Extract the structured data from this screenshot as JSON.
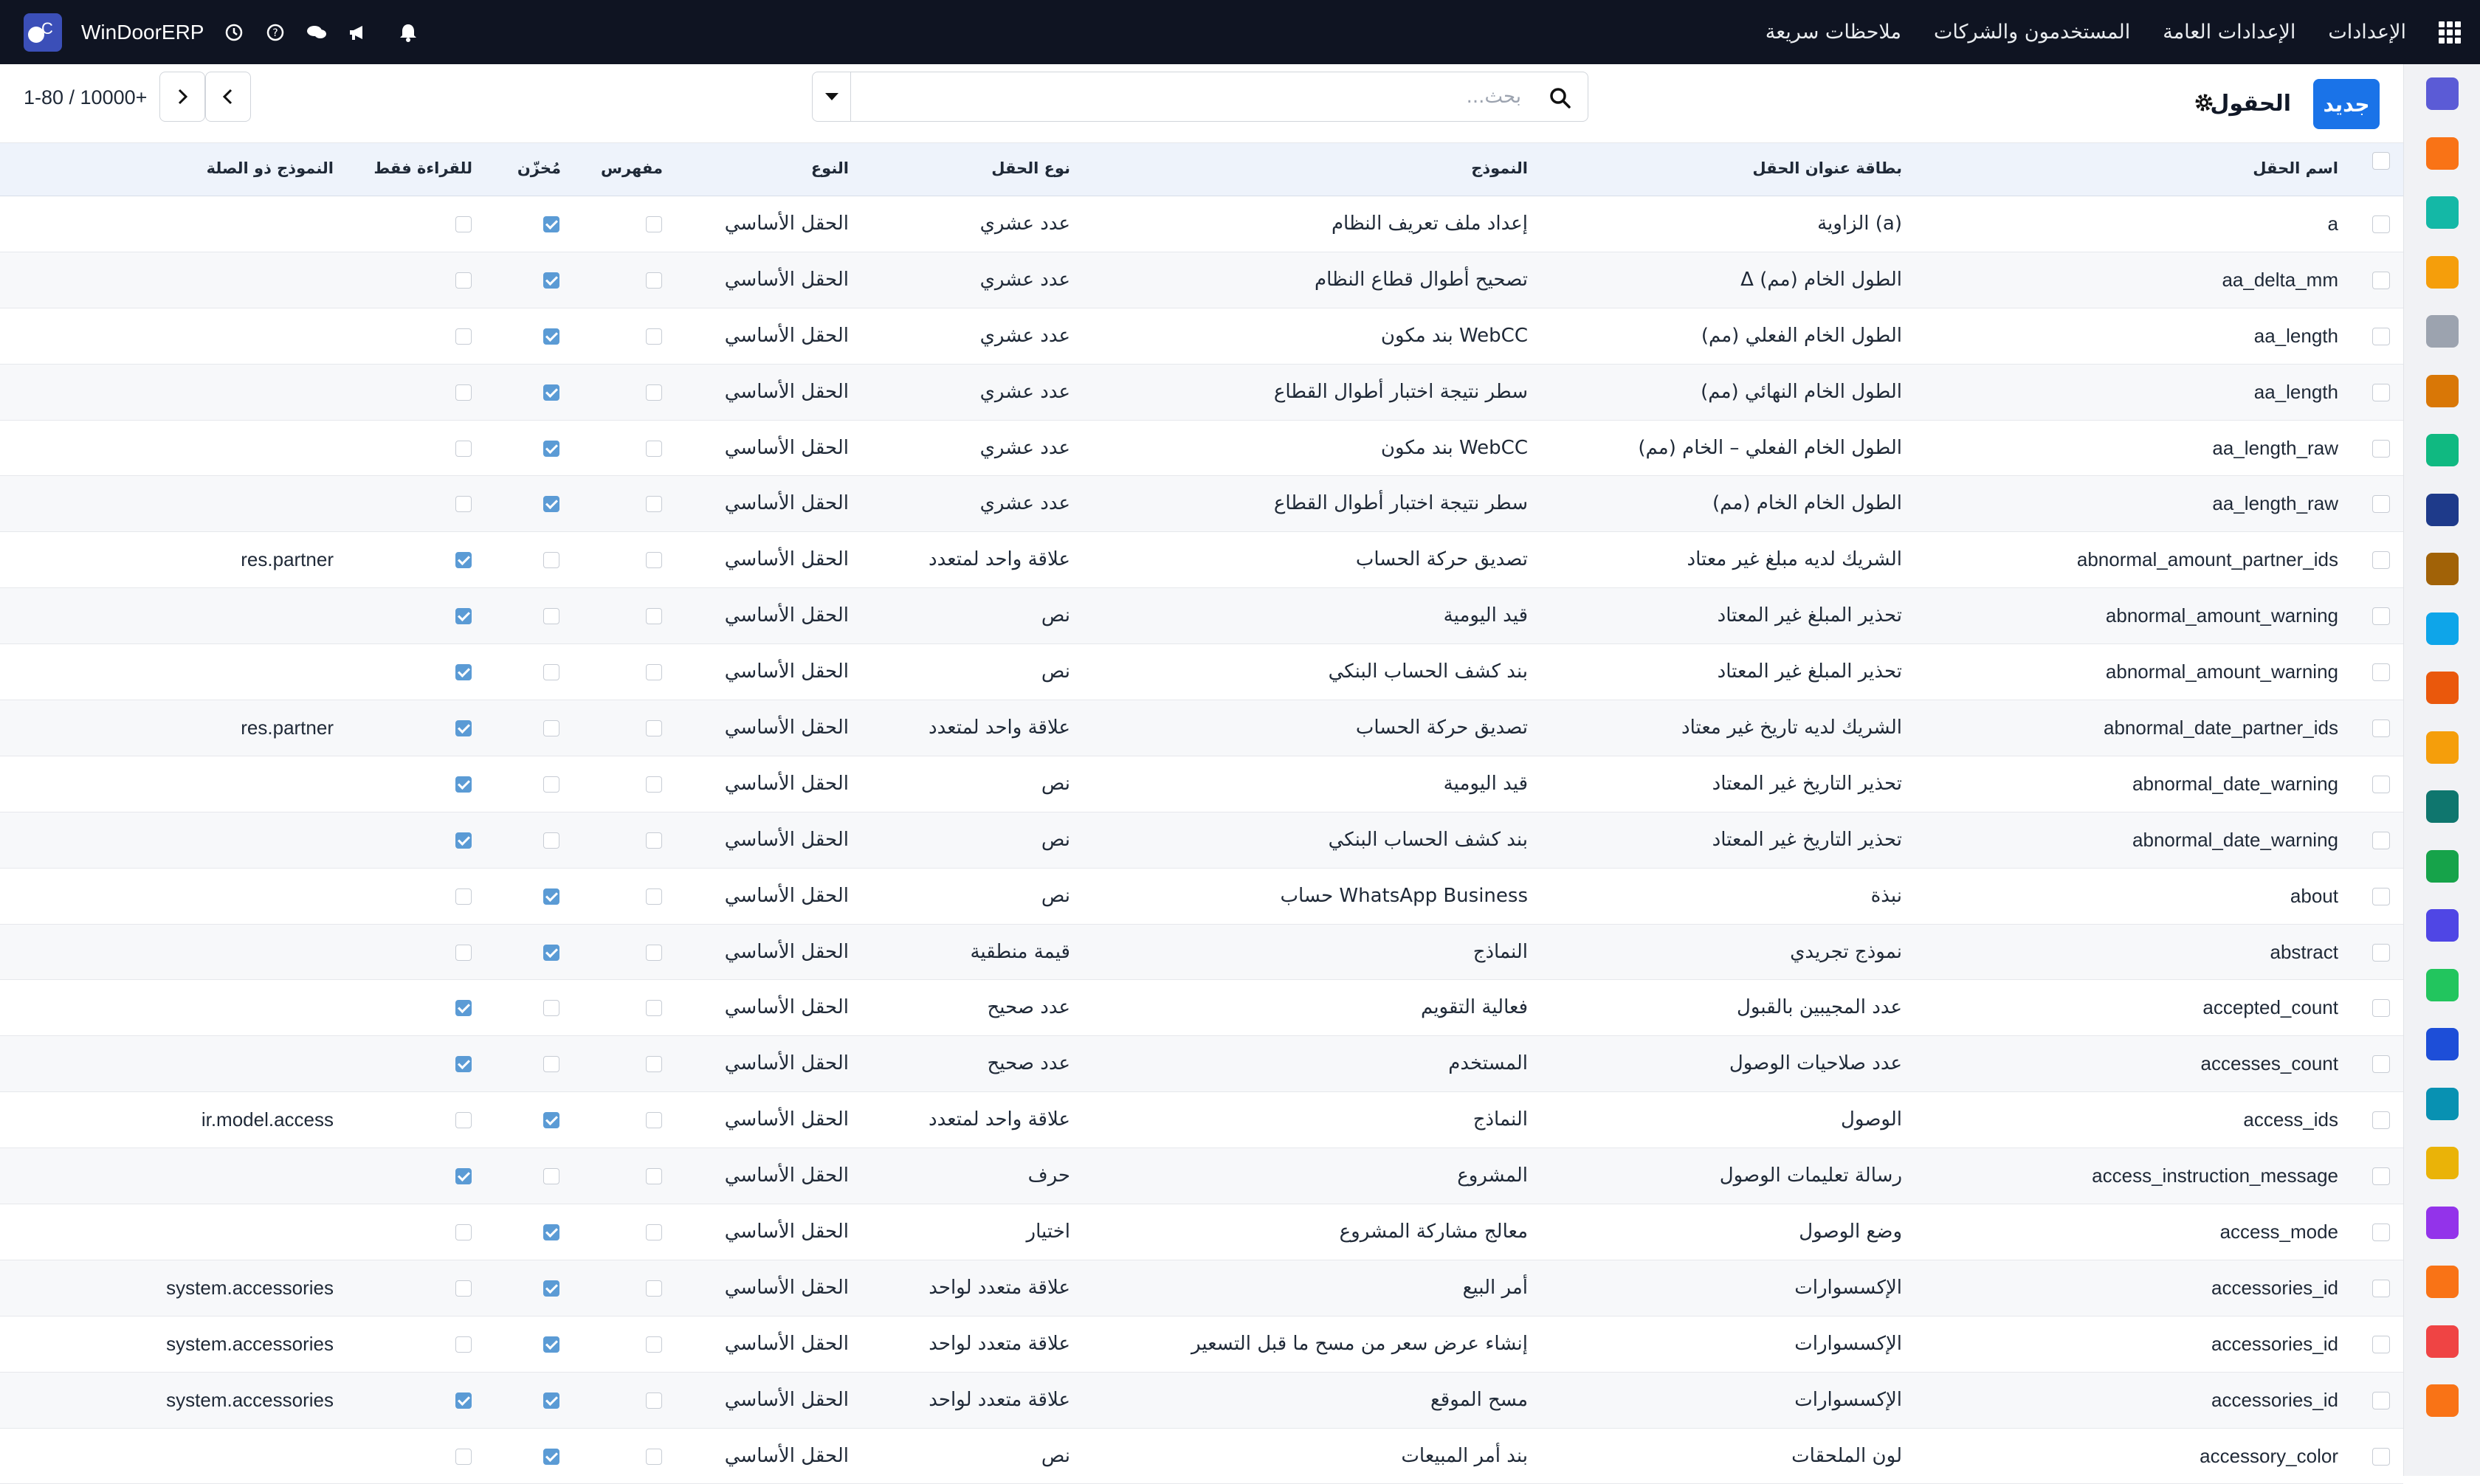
{
  "navbar": {
    "brand": "WinDoorERP",
    "menu": [
      "الإعدادات",
      "الإعدادات العامة",
      "المستخدمون والشركات",
      "ملاحظات سريعة"
    ]
  },
  "control": {
    "new_button": "جديد",
    "title": "الحقول",
    "search_placeholder": "بحث...",
    "pager": "1-80 / 10000+"
  },
  "columns": [
    "اسم الحقل",
    "بطاقة عنوان الحقل",
    "النموذج",
    "نوع الحقل",
    "النوع",
    "مفهرس",
    "مُخزّن",
    "للقراءة فقط",
    "النموذج ذو الصلة"
  ],
  "rows": [
    {
      "name": "a",
      "label": "الزاوية (a)",
      "model": "إعداد ملف تعريف النظام",
      "ftype": "عدد عشري",
      "kind": "الحقل الأساسي",
      "indexed": false,
      "stored": true,
      "readonly": false,
      "relation": ""
    },
    {
      "name": "aa_delta_mm",
      "label": "Δ الطول الخام (مم)",
      "model": "تصحيح أطوال قطاع النظام",
      "ftype": "عدد عشري",
      "kind": "الحقل الأساسي",
      "indexed": false,
      "stored": true,
      "readonly": false,
      "relation": ""
    },
    {
      "name": "aa_length",
      "label": "الطول الخام الفعلي (مم)",
      "model": "بند مكون WebCC",
      "ftype": "عدد عشري",
      "kind": "الحقل الأساسي",
      "indexed": false,
      "stored": true,
      "readonly": false,
      "relation": ""
    },
    {
      "name": "aa_length",
      "label": "الطول الخام النهائي (مم)",
      "model": "سطر نتيجة اختبار أطوال القطاع",
      "ftype": "عدد عشري",
      "kind": "الحقل الأساسي",
      "indexed": false,
      "stored": true,
      "readonly": false,
      "relation": ""
    },
    {
      "name": "aa_length_raw",
      "label": "الطول الخام الفعلي – الخام (مم)",
      "model": "بند مكون WebCC",
      "ftype": "عدد عشري",
      "kind": "الحقل الأساسي",
      "indexed": false,
      "stored": true,
      "readonly": false,
      "relation": ""
    },
    {
      "name": "aa_length_raw",
      "label": "الطول الخام الخام (مم)",
      "model": "سطر نتيجة اختبار أطوال القطاع",
      "ftype": "عدد عشري",
      "kind": "الحقل الأساسي",
      "indexed": false,
      "stored": true,
      "readonly": false,
      "relation": ""
    },
    {
      "name": "abnormal_amount_partner_ids",
      "label": "الشريك لديه مبلغ غير معتاد",
      "model": "تصديق حركة الحساب",
      "ftype": "علاقة واحد لمتعدد",
      "kind": "الحقل الأساسي",
      "indexed": false,
      "stored": false,
      "readonly": true,
      "relation": "res.partner"
    },
    {
      "name": "abnormal_amount_warning",
      "label": "تحذير المبلغ غير المعتاد",
      "model": "قيد اليومية",
      "ftype": "نص",
      "kind": "الحقل الأساسي",
      "indexed": false,
      "stored": false,
      "readonly": true,
      "relation": ""
    },
    {
      "name": "abnormal_amount_warning",
      "label": "تحذير المبلغ غير المعتاد",
      "model": "بند كشف الحساب البنكي",
      "ftype": "نص",
      "kind": "الحقل الأساسي",
      "indexed": false,
      "stored": false,
      "readonly": true,
      "relation": ""
    },
    {
      "name": "abnormal_date_partner_ids",
      "label": "الشريك لديه تاريخ غير معتاد",
      "model": "تصديق حركة الحساب",
      "ftype": "علاقة واحد لمتعدد",
      "kind": "الحقل الأساسي",
      "indexed": false,
      "stored": false,
      "readonly": true,
      "relation": "res.partner"
    },
    {
      "name": "abnormal_date_warning",
      "label": "تحذير التاريخ غير المعتاد",
      "model": "قيد اليومية",
      "ftype": "نص",
      "kind": "الحقل الأساسي",
      "indexed": false,
      "stored": false,
      "readonly": true,
      "relation": ""
    },
    {
      "name": "abnormal_date_warning",
      "label": "تحذير التاريخ غير المعتاد",
      "model": "بند كشف الحساب البنكي",
      "ftype": "نص",
      "kind": "الحقل الأساسي",
      "indexed": false,
      "stored": false,
      "readonly": true,
      "relation": ""
    },
    {
      "name": "about",
      "label": "نبذة",
      "model": "حساب WhatsApp Business",
      "ftype": "نص",
      "kind": "الحقل الأساسي",
      "indexed": false,
      "stored": true,
      "readonly": false,
      "relation": ""
    },
    {
      "name": "abstract",
      "label": "نموذج تجريدي",
      "model": "النماذج",
      "ftype": "قيمة منطقية",
      "kind": "الحقل الأساسي",
      "indexed": false,
      "stored": true,
      "readonly": false,
      "relation": ""
    },
    {
      "name": "accepted_count",
      "label": "عدد المجيبين بالقبول",
      "model": "فعالية التقويم",
      "ftype": "عدد صحيح",
      "kind": "الحقل الأساسي",
      "indexed": false,
      "stored": false,
      "readonly": true,
      "relation": ""
    },
    {
      "name": "accesses_count",
      "label": "عدد صلاحيات الوصول",
      "model": "المستخدم",
      "ftype": "عدد صحيح",
      "kind": "الحقل الأساسي",
      "indexed": false,
      "stored": false,
      "readonly": true,
      "relation": ""
    },
    {
      "name": "access_ids",
      "label": "الوصول",
      "model": "النماذج",
      "ftype": "علاقة واحد لمتعدد",
      "kind": "الحقل الأساسي",
      "indexed": false,
      "stored": true,
      "readonly": false,
      "relation": "ir.model.access"
    },
    {
      "name": "access_instruction_message",
      "label": "رسالة تعليمات الوصول",
      "model": "المشروع",
      "ftype": "حرف",
      "kind": "الحقل الأساسي",
      "indexed": false,
      "stored": false,
      "readonly": true,
      "relation": ""
    },
    {
      "name": "access_mode",
      "label": "وضع الوصول",
      "model": "معالج مشاركة المشروع",
      "ftype": "اختيار",
      "kind": "الحقل الأساسي",
      "indexed": false,
      "stored": true,
      "readonly": false,
      "relation": ""
    },
    {
      "name": "accessories_id",
      "label": "الإكسسوارات",
      "model": "أمر البيع",
      "ftype": "علاقة متعدد لواحد",
      "kind": "الحقل الأساسي",
      "indexed": false,
      "stored": true,
      "readonly": false,
      "relation": "system.accessories"
    },
    {
      "name": "accessories_id",
      "label": "الإكسسوارات",
      "model": "إنشاء عرض سعر من مسح ما قبل التسعير",
      "ftype": "علاقة متعدد لواحد",
      "kind": "الحقل الأساسي",
      "indexed": false,
      "stored": true,
      "readonly": false,
      "relation": "system.accessories"
    },
    {
      "name": "accessories_id",
      "label": "الإكسسوارات",
      "model": "مسح الموقع",
      "ftype": "علاقة متعدد لواحد",
      "kind": "الحقل الأساسي",
      "indexed": false,
      "stored": true,
      "readonly": true,
      "relation": "system.accessories"
    },
    {
      "name": "accessory_color",
      "label": "لون الملحقات",
      "model": "بند أمر المبيعات",
      "ftype": "نص",
      "kind": "الحقل الأساسي",
      "indexed": false,
      "stored": true,
      "readonly": false,
      "relation": ""
    }
  ],
  "sidebar_apps": [
    {
      "icon": "mail-app-icon",
      "color": "#5b5bd6"
    },
    {
      "icon": "chat-app-icon",
      "color": "#f97316"
    },
    {
      "icon": "sales-app-icon",
      "color": "#14b8a6"
    },
    {
      "icon": "reports-app-icon",
      "color": "#f59e0b"
    },
    {
      "icon": "inventory-app-icon",
      "color": "#9ca3af"
    },
    {
      "icon": "contacts-app-icon",
      "color": "#d97706"
    },
    {
      "icon": "tasks-app-icon",
      "color": "#10b981"
    },
    {
      "icon": "documents-app-icon",
      "color": "#1e3a8a"
    },
    {
      "icon": "products-app-icon",
      "color": "#a16207"
    },
    {
      "icon": "invoice-app-icon",
      "color": "#0ea5e9"
    },
    {
      "icon": "employees-app-icon",
      "color": "#ea580c"
    },
    {
      "icon": "calendar-app-icon",
      "color": "#f59e0b"
    },
    {
      "icon": "sign-app-icon",
      "color": "#0f766e"
    },
    {
      "icon": "profile-app-icon",
      "color": "#16a34a"
    },
    {
      "icon": "dashboard-app-icon",
      "color": "#4f46e5"
    },
    {
      "icon": "whatsapp-app-icon",
      "color": "#22c55e"
    },
    {
      "icon": "discuss-app-icon",
      "color": "#1d4ed8"
    },
    {
      "icon": "website-app-icon",
      "color": "#0891b2"
    },
    {
      "icon": "telegram-app-icon",
      "color": "#eab308"
    },
    {
      "icon": "accounting-app-icon",
      "color": "#9333ea"
    },
    {
      "icon": "manufacturing-app-icon",
      "color": "#f97316"
    },
    {
      "icon": "settings-app-icon",
      "color": "#ef4444"
    },
    {
      "icon": "plugin-app-icon",
      "color": "#f97316"
    }
  ]
}
